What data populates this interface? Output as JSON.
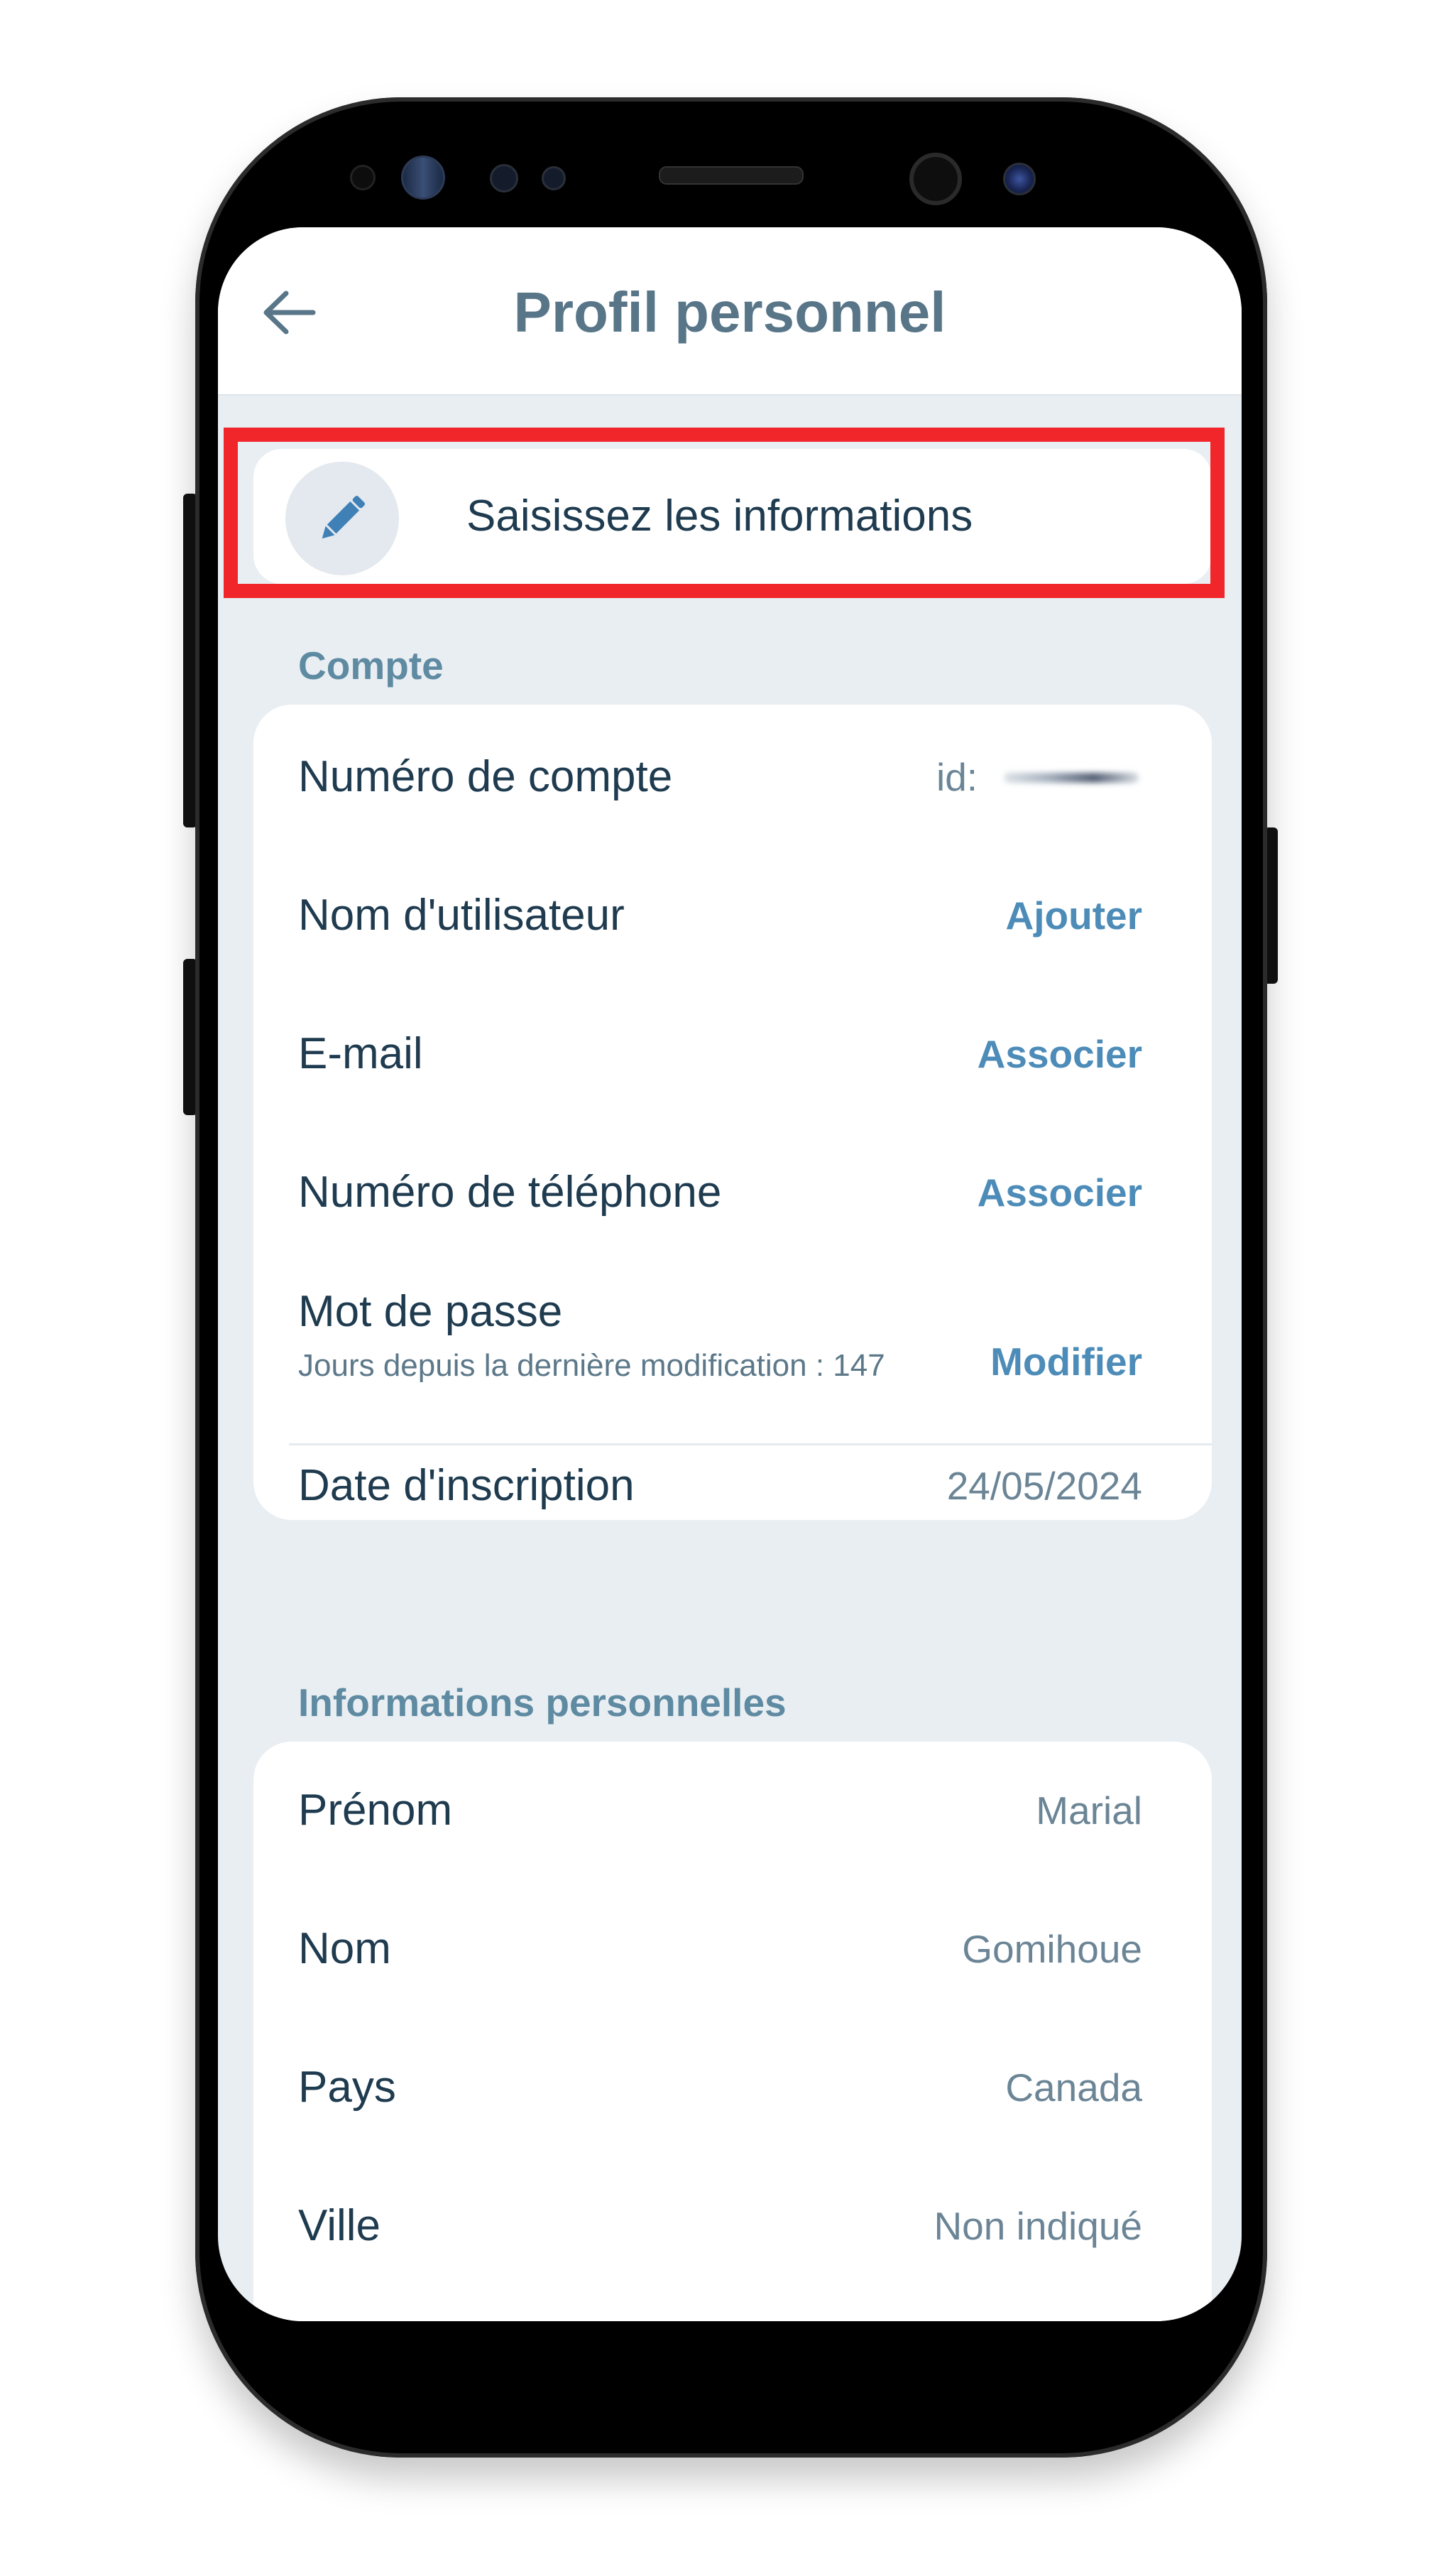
{
  "header": {
    "title": "Profil personnel",
    "back_icon": "arrow-left-icon"
  },
  "edit_card": {
    "icon": "pencil-icon",
    "label": "Saisissez les informations"
  },
  "account_section": {
    "title": "Compte",
    "rows": {
      "account_number": {
        "label": "Numéro de compte",
        "value_prefix": "id:"
      },
      "username": {
        "label": "Nom d'utilisateur",
        "action": "Ajouter"
      },
      "email": {
        "label": "E-mail",
        "action": "Associer"
      },
      "phone": {
        "label": "Numéro de téléphone",
        "action": "Associer"
      },
      "password": {
        "label": "Mot de passe",
        "sublabel": "Jours depuis la dernière modification : 147",
        "action": "Modifier"
      },
      "registration_date": {
        "label": "Date d'inscription",
        "value": "24/05/2024"
      }
    }
  },
  "personal_section": {
    "title": "Informations personnelles",
    "rows": {
      "first_name": {
        "label": "Prénom",
        "value": "Marial"
      },
      "last_name": {
        "label": "Nom",
        "value": "Gomihoue"
      },
      "country": {
        "label": "Pays",
        "value": "Canada"
      },
      "city": {
        "label": "Ville",
        "value": "Non indiqué"
      }
    }
  },
  "colors": {
    "accent": "#4d8cb8",
    "title": "#587688",
    "highlight": "#f0262b",
    "background": "#e9eef2"
  }
}
